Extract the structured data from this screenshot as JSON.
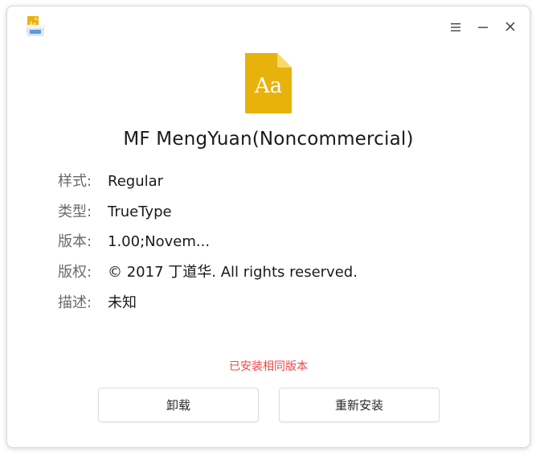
{
  "window": {
    "controls": {
      "menu": "menu-icon",
      "minimize": "minimize-icon",
      "close": "close-icon"
    }
  },
  "font": {
    "icon_text": "Aa",
    "name": "MF MengYuan(Noncommercial)"
  },
  "info": [
    {
      "label": "样式:",
      "value": "Regular"
    },
    {
      "label": "类型:",
      "value": "TrueType"
    },
    {
      "label": "版本:",
      "value": "1.00;Novem..."
    },
    {
      "label": "版权:",
      "value": "© 2017 丁道华. All rights reserved."
    },
    {
      "label": "描述:",
      "value": "未知"
    }
  ],
  "status": "已安装相同版本",
  "buttons": {
    "uninstall": "卸载",
    "reinstall": "重新安装"
  },
  "colors": {
    "file_icon": "#e8b20c",
    "status": "#ef4646"
  }
}
